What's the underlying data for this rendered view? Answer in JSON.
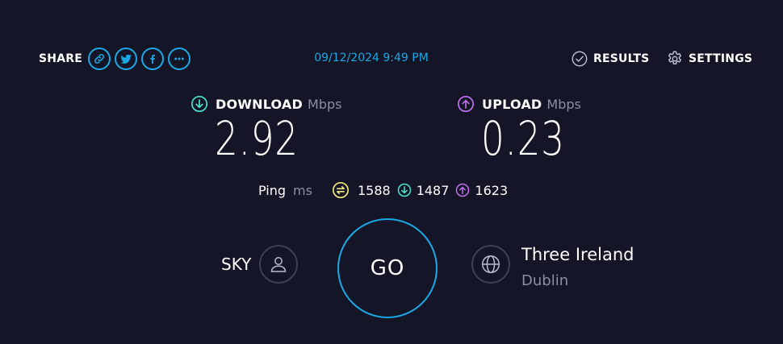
{
  "colors": {
    "background": "#141526",
    "accent": "#1aa9e6",
    "download": "#47e6d1",
    "upload": "#bf71f0",
    "ping": "#f0e87a",
    "muted": "#8a8fa3"
  },
  "header": {
    "share_label": "SHARE",
    "share_buttons": [
      {
        "icon": "link-icon"
      },
      {
        "icon": "twitter-icon"
      },
      {
        "icon": "facebook-icon"
      },
      {
        "icon": "more-icon"
      }
    ],
    "timestamp": "09/12/2024 9:49 PM",
    "results_label": "RESULTS",
    "settings_label": "SETTINGS"
  },
  "download": {
    "label": "DOWNLOAD",
    "unit": "Mbps",
    "value": "2.92",
    "icon": "download-arrow-icon"
  },
  "upload": {
    "label": "UPLOAD",
    "unit": "Mbps",
    "value": "0.23",
    "icon": "upload-arrow-icon"
  },
  "ping": {
    "label": "Ping",
    "unit": "ms",
    "idle": "1588",
    "download": "1487",
    "upload": "1623"
  },
  "isp": {
    "name": "SKY",
    "icon": "user-icon"
  },
  "go_button": {
    "label": "GO"
  },
  "server": {
    "name": "Three Ireland",
    "location": "Dublin",
    "icon": "globe-icon"
  }
}
